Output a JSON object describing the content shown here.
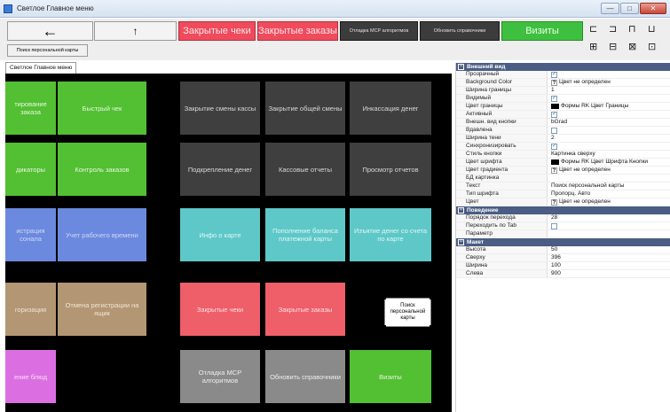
{
  "window": {
    "title": "Светлое Главное меню",
    "buttons": {
      "minimize": "—",
      "maximize": "□",
      "close": "✕"
    }
  },
  "toolbar": {
    "back_label": "←",
    "up_label": "↑",
    "closed_checks_label": "Закрытые чеки",
    "closed_orders_label": "Закрытые заказы",
    "debug_msr_label": "Отладка MCP алгоритмов",
    "refresh_refs_label": "Обновить справочники",
    "visits_label": "Визиты",
    "search_card_label": "Поиск персональной карты",
    "align_icons": [
      "align-left",
      "align-center",
      "align-top",
      "align-right",
      "same-size",
      "same-width",
      "same-height",
      "spacing"
    ]
  },
  "tab": {
    "label": "Светлое Главное меню"
  },
  "canvas": {
    "tiles": [
      {
        "label": "тирование заказа"
      },
      {
        "label": "Быстрый чек"
      },
      {
        "label": "Закрытие смены кассы"
      },
      {
        "label": "Закрытие общей смены"
      },
      {
        "label": "Инкассация денег"
      },
      {
        "label": "дикаторы"
      },
      {
        "label": "Контроль заказов"
      },
      {
        "label": "Подкрепление денег"
      },
      {
        "label": "Кассовые отчеты"
      },
      {
        "label": "Просмотр отчетов"
      },
      {
        "label": "истрация сонала"
      },
      {
        "label": "Учет рабочего времени"
      },
      {
        "label": "Инфо о карте"
      },
      {
        "label": "Пополнение баланса платежной карты"
      },
      {
        "label": "Изъятие денег со счета по карте"
      },
      {
        "label": "горизация"
      },
      {
        "label": "Отмена регистрации на ящик"
      },
      {
        "label": "Закрытые чеки"
      },
      {
        "label": "Закрытые заказы"
      },
      {
        "label": "ение блюд"
      },
      {
        "label": "Отладка MCP алгоритмов"
      },
      {
        "label": "Обновить справочники"
      },
      {
        "label": "Визиты"
      }
    ],
    "selected_button_label": "Поиск персональной карты"
  },
  "properties": {
    "categories": [
      {
        "name": "Внешний вид",
        "rows": [
          {
            "key": "Прозрачный",
            "value": "",
            "kind": "check",
            "checked": true
          },
          {
            "key": "Background Color",
            "value": "Цвет не определен",
            "kind": "color-unset"
          },
          {
            "key": "Ширина границы",
            "value": "1",
            "kind": "text"
          },
          {
            "key": "Видимый",
            "value": "",
            "kind": "check",
            "checked": true
          },
          {
            "key": "Цвет границы",
            "value": "Формы RK Цвет Границы",
            "kind": "color-black"
          },
          {
            "key": "Активный",
            "value": "",
            "kind": "check",
            "checked": true
          },
          {
            "key": "Внешн. вид кнопки",
            "value": "bGrad",
            "kind": "text"
          },
          {
            "key": "Вдавлена",
            "value": "",
            "kind": "check",
            "checked": false
          },
          {
            "key": "Ширина тени",
            "value": "2",
            "kind": "text"
          },
          {
            "key": "Синхронизировать",
            "value": "",
            "kind": "check",
            "checked": true
          },
          {
            "key": "Стиль кнопки",
            "value": "Картинка сверху",
            "kind": "text"
          },
          {
            "key": "Цвет шрифта",
            "value": "Формы RK Цвет Шрифта Кнопки",
            "kind": "color-black"
          },
          {
            "key": "Цвет градиента",
            "value": "Цвет не определен",
            "kind": "color-unset"
          },
          {
            "key": "БД картинка",
            "value": "",
            "kind": "text"
          },
          {
            "key": "Текст",
            "value": "Поиск персональной карты",
            "kind": "text"
          },
          {
            "key": "Тип шрифта",
            "value": "Пропорц. Авто",
            "kind": "text"
          },
          {
            "key": "Цвет",
            "value": "Цвет не определен",
            "kind": "color-unset"
          }
        ]
      },
      {
        "name": "Поведение",
        "rows": [
          {
            "key": "Порядок перехода",
            "value": "28",
            "kind": "text"
          },
          {
            "key": "Переходить по Tab",
            "value": "",
            "kind": "check",
            "checked": false
          },
          {
            "key": "Параметр",
            "value": "",
            "kind": "text"
          }
        ]
      },
      {
        "name": "Макет",
        "rows": [
          {
            "key": "Высота",
            "value": "50",
            "kind": "text"
          },
          {
            "key": "Сверху",
            "value": "396",
            "kind": "text"
          },
          {
            "key": "Ширина",
            "value": "100",
            "kind": "text"
          },
          {
            "key": "Слева",
            "value": "900",
            "kind": "text"
          }
        ]
      }
    ]
  },
  "colors": {
    "green": "#53bf32",
    "dark": "#3f3f3f",
    "blue": "#6b89de",
    "teal": "#5ec8c8",
    "red": "#ee5f6a",
    "tan": "#b39673",
    "gray": "#8a8a8a",
    "pink": "#db6fe2",
    "category_header": "#4b5d84"
  }
}
